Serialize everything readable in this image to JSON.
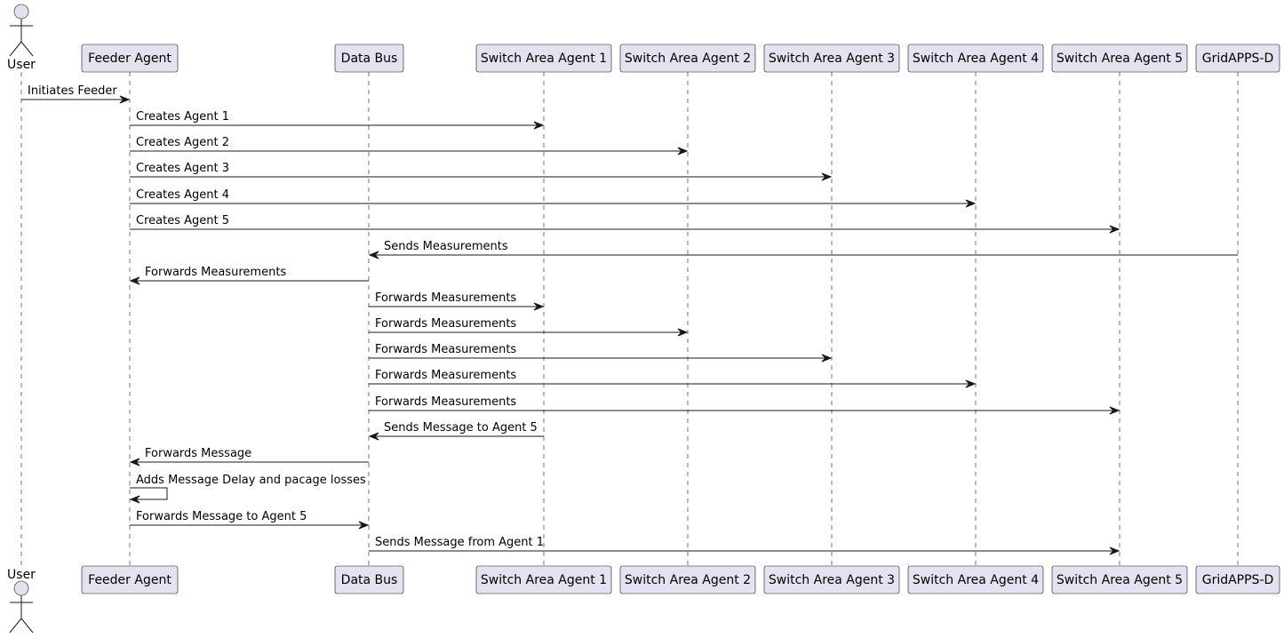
{
  "participants": [
    {
      "id": "user",
      "label": "User",
      "kind": "actor"
    },
    {
      "id": "feeder",
      "label": "Feeder Agent",
      "kind": "box"
    },
    {
      "id": "bus",
      "label": "Data Bus",
      "kind": "box"
    },
    {
      "id": "sa1",
      "label": "Switch Area Agent 1",
      "kind": "box"
    },
    {
      "id": "sa2",
      "label": "Switch Area Agent 2",
      "kind": "box"
    },
    {
      "id": "sa3",
      "label": "Switch Area Agent 3",
      "kind": "box"
    },
    {
      "id": "sa4",
      "label": "Switch Area Agent 4",
      "kind": "box"
    },
    {
      "id": "sa5",
      "label": "Switch Area Agent 5",
      "kind": "box"
    },
    {
      "id": "gridapps",
      "label": "GridAPPS-D",
      "kind": "box"
    }
  ],
  "messages": [
    {
      "from": "user",
      "to": "feeder",
      "label": "Initiates Feeder"
    },
    {
      "from": "feeder",
      "to": "sa1",
      "label": "Creates Agent 1"
    },
    {
      "from": "feeder",
      "to": "sa2",
      "label": "Creates Agent 2"
    },
    {
      "from": "feeder",
      "to": "sa3",
      "label": "Creates Agent 3"
    },
    {
      "from": "feeder",
      "to": "sa4",
      "label": "Creates Agent 4"
    },
    {
      "from": "feeder",
      "to": "sa5",
      "label": "Creates Agent 5"
    },
    {
      "from": "gridapps",
      "to": "bus",
      "label": "Sends Measurements"
    },
    {
      "from": "bus",
      "to": "feeder",
      "label": "Forwards Measurements"
    },
    {
      "from": "bus",
      "to": "sa1",
      "label": "Forwards Measurements"
    },
    {
      "from": "bus",
      "to": "sa2",
      "label": "Forwards Measurements"
    },
    {
      "from": "bus",
      "to": "sa3",
      "label": "Forwards Measurements"
    },
    {
      "from": "bus",
      "to": "sa4",
      "label": "Forwards Measurements"
    },
    {
      "from": "bus",
      "to": "sa5",
      "label": "Forwards Measurements"
    },
    {
      "from": "sa1",
      "to": "bus",
      "label": "Sends Message to Agent 5"
    },
    {
      "from": "bus",
      "to": "feeder",
      "label": "Forwards Message"
    },
    {
      "from": "feeder",
      "to": "feeder",
      "label": "Adds Message Delay and pacage losses"
    },
    {
      "from": "feeder",
      "to": "bus",
      "label": "Forwards Message to Agent 5"
    },
    {
      "from": "bus",
      "to": "sa5",
      "label": "Sends Message from Agent 1"
    }
  ]
}
